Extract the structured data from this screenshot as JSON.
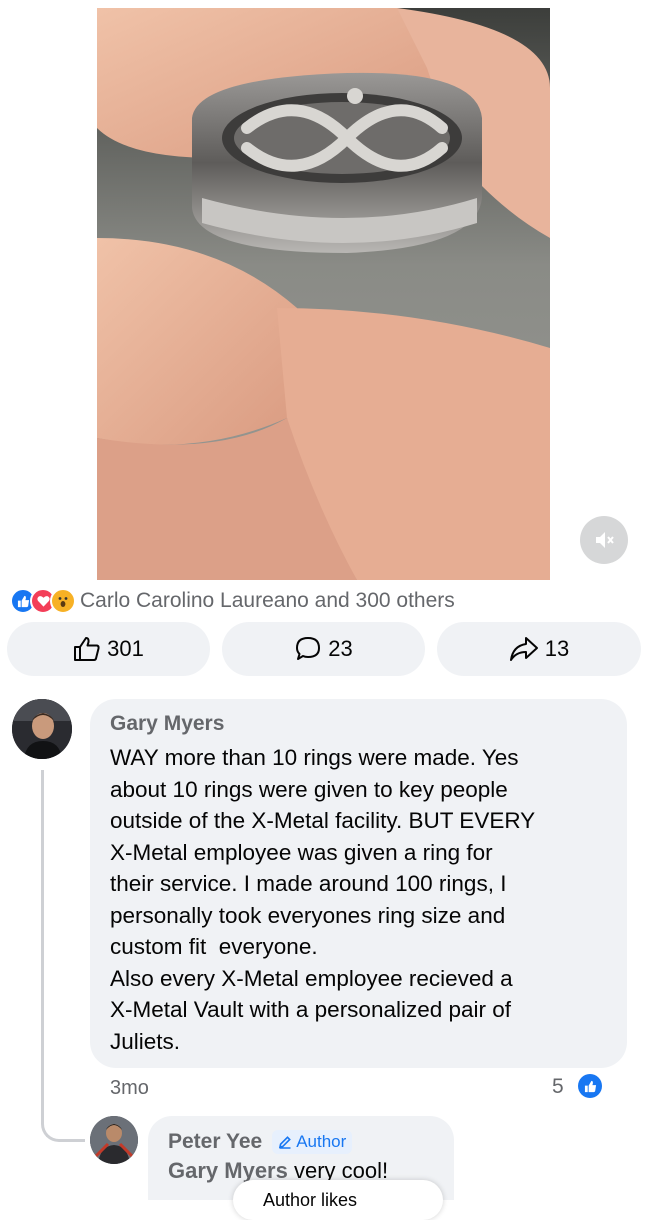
{
  "post": {
    "reactions": {
      "types": [
        "like-icon",
        "love-icon",
        "wow-icon"
      ],
      "summary": "Carlo Carolino Laureano and 300 others",
      "colors": {
        "like": "#1877f2",
        "love": "#f33e58",
        "wow": "#f7b125"
      }
    },
    "actions": {
      "like_count": "301",
      "comment_count": "23",
      "share_count": "13"
    }
  },
  "comments": [
    {
      "author": "Gary Myers",
      "lines": [
        "WAY more than 10 rings were made. Yes",
        "about 10 rings were given to key people",
        "outside of the X-Metal facility. BUT EVERY",
        "X-Metal employee was given a ring for",
        "their service. I made around 100 rings, I",
        "personally took everyones ring size and",
        "custom fit  everyone.",
        "Also every X-Metal employee recieved a",
        "X-Metal Vault with a personalized pair of",
        "Juliets."
      ],
      "time": "3mo",
      "like_count": "5"
    },
    {
      "author": "Peter Yee",
      "badge": "Author",
      "mention": "Gary Myers",
      "text": " very cool!"
    }
  ],
  "peek_chip": "Author likes"
}
